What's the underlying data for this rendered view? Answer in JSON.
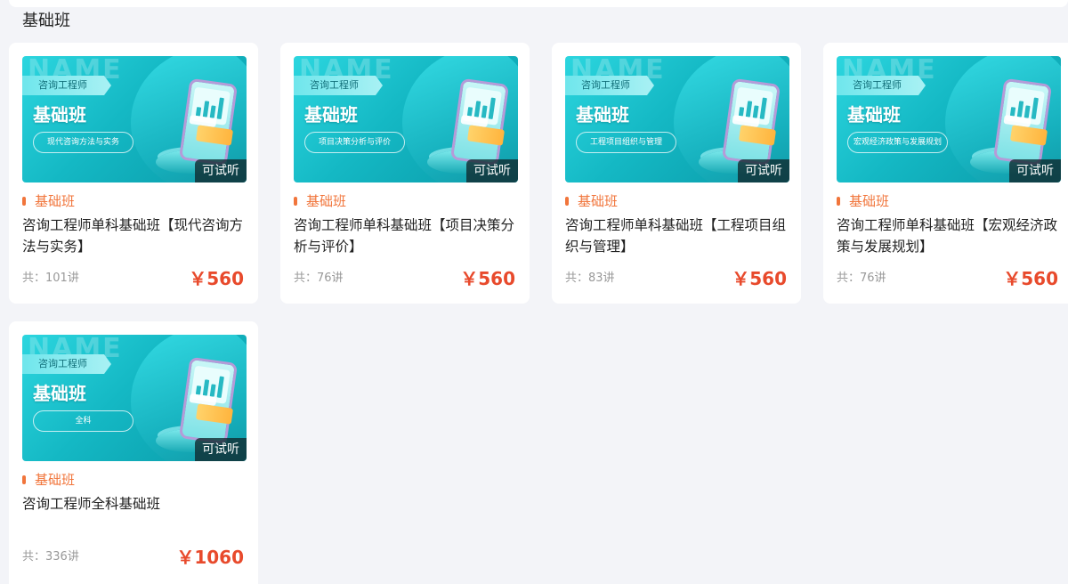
{
  "section": {
    "title": "基础班"
  },
  "colors": {
    "accent": "#f1753b",
    "price": "#e84a2c",
    "thumb": "#14b8c4"
  },
  "cards": [
    {
      "thumb": {
        "ghost": "NAME",
        "ribbon": "咨询工程师",
        "heading": "基础班",
        "subject": "现代咨询方法与实务"
      },
      "badge": "可试听",
      "tag": "基础班",
      "title": "咨询工程师单科基础班【现代咨询方法与实务】",
      "lessons": "共：101讲",
      "price": "￥560"
    },
    {
      "thumb": {
        "ghost": "NAME",
        "ribbon": "咨询工程师",
        "heading": "基础班",
        "subject": "项目决策分析与评价"
      },
      "badge": "可试听",
      "tag": "基础班",
      "title": "咨询工程师单科基础班【项目决策分析与评价】",
      "lessons": "共：76讲",
      "price": "￥560"
    },
    {
      "thumb": {
        "ghost": "NAME",
        "ribbon": "咨询工程师",
        "heading": "基础班",
        "subject": "工程项目组织与管理"
      },
      "badge": "可试听",
      "tag": "基础班",
      "title": "咨询工程师单科基础班【工程项目组织与管理】",
      "lessons": "共：83讲",
      "price": "￥560"
    },
    {
      "thumb": {
        "ghost": "NAME",
        "ribbon": "咨询工程师",
        "heading": "基础班",
        "subject": "宏观经济政策与发展规划"
      },
      "badge": "可试听",
      "tag": "基础班",
      "title": "咨询工程师单科基础班【宏观经济政策与发展规划】",
      "lessons": "共：76讲",
      "price": "￥560"
    },
    {
      "thumb": {
        "ghost": "NAME",
        "ribbon": "咨询工程师",
        "heading": "基础班",
        "subject": "全科"
      },
      "badge": "可试听",
      "tag": "基础班",
      "title": "咨询工程师全科基础班",
      "lessons": "共：336讲",
      "price": "￥1060"
    }
  ]
}
